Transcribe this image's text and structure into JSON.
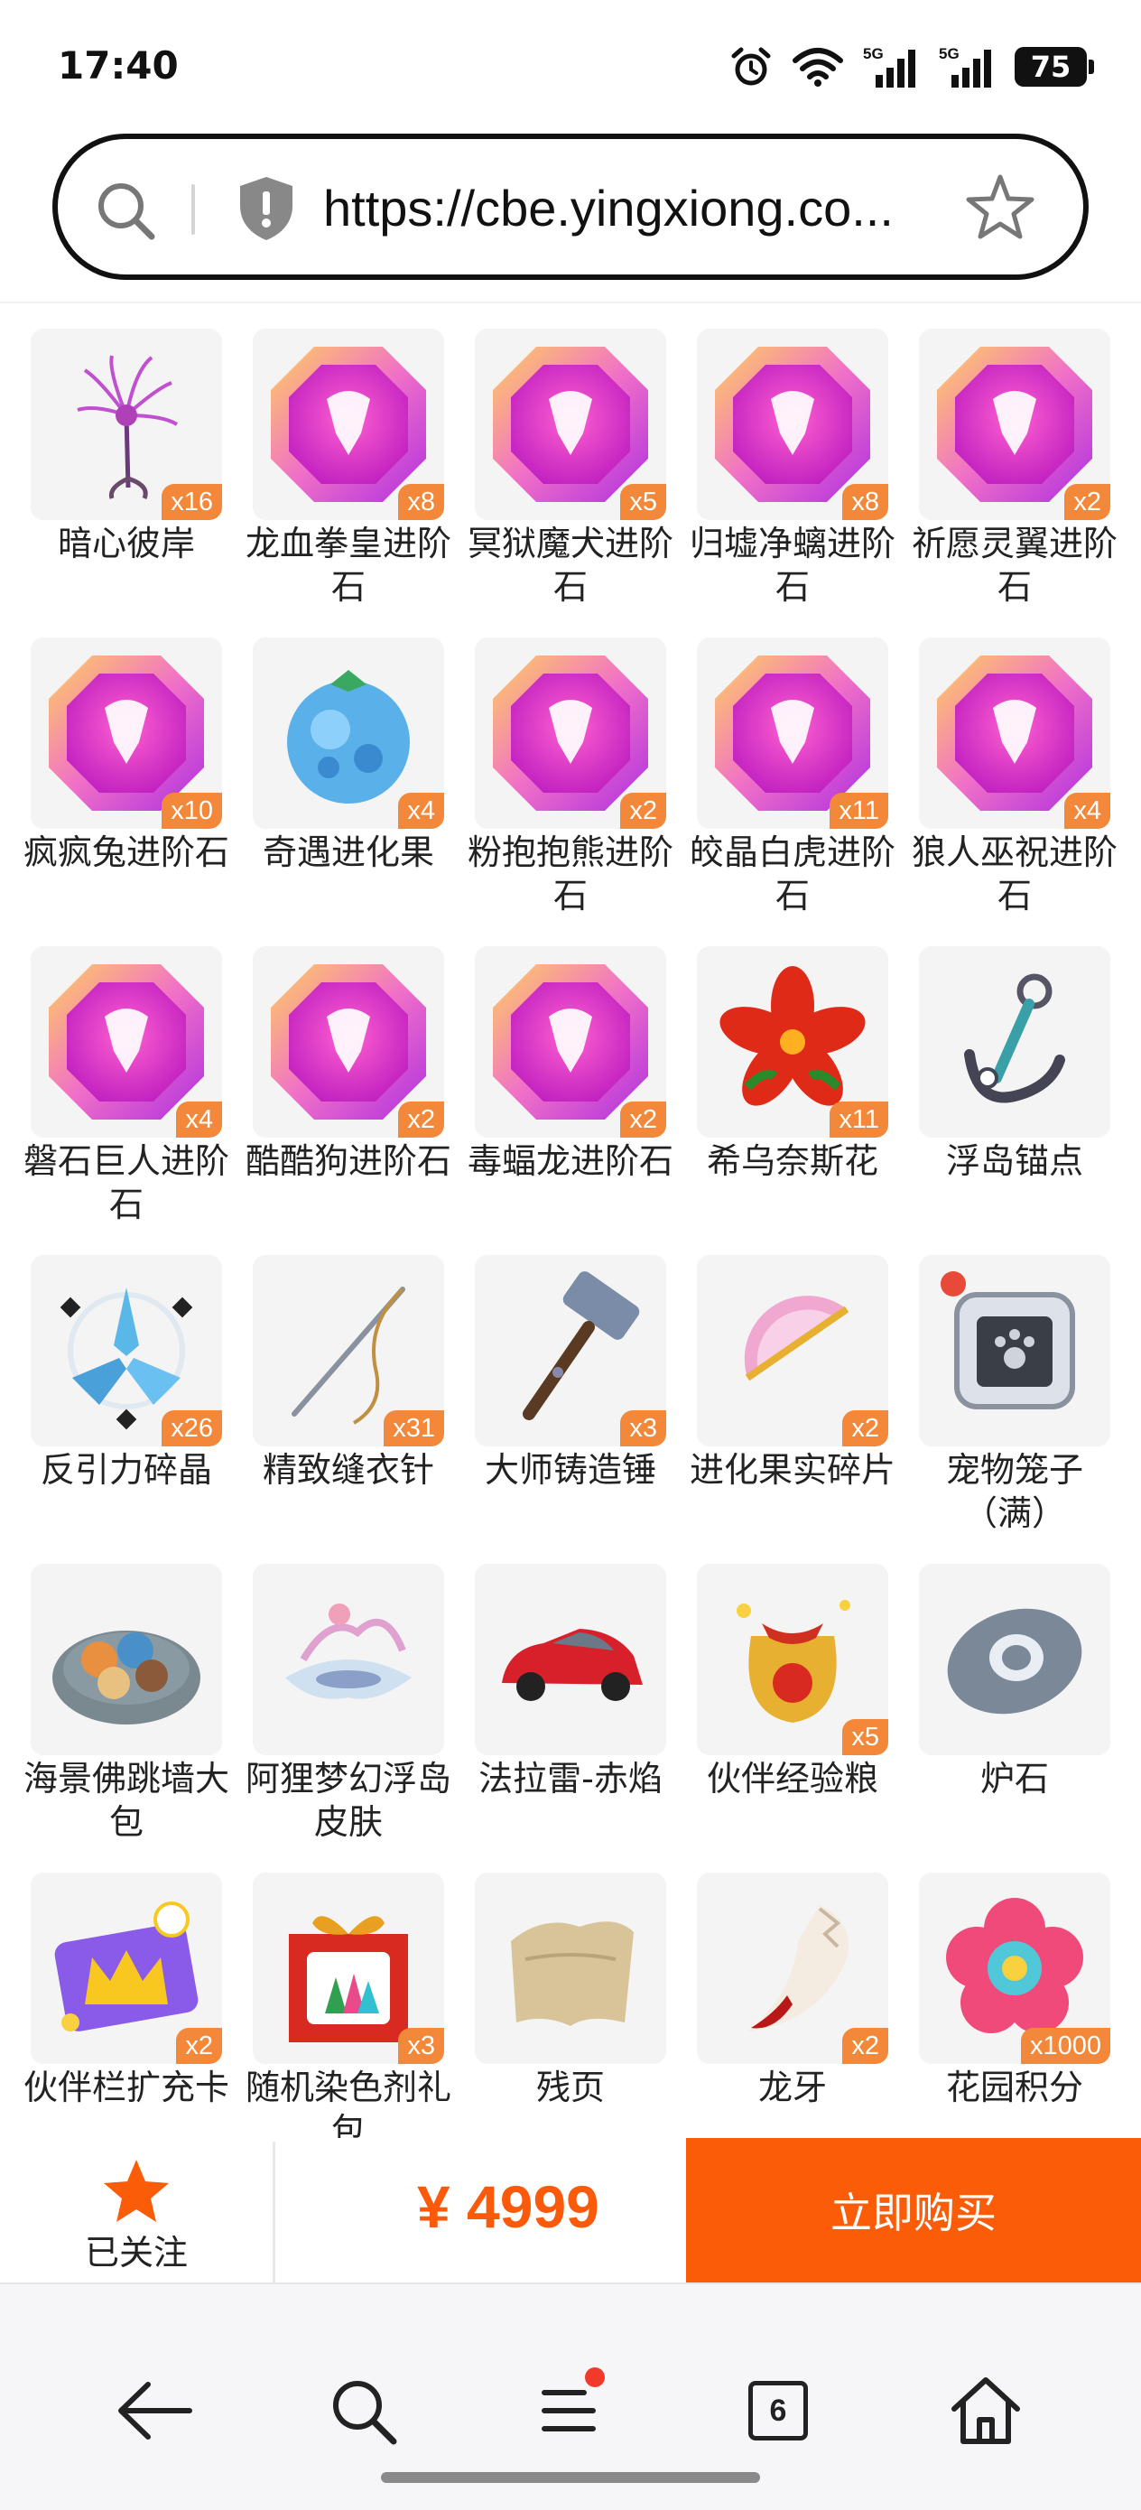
{
  "status_bar": {
    "time": "17:40",
    "battery": "75",
    "icons": [
      "alarm-icon",
      "wifi-icon",
      "signal-5g-icon",
      "signal-5g-icon",
      "battery-icon"
    ]
  },
  "browser": {
    "url": "https://cbe.yingxiong.co...",
    "icons": [
      "search-icon",
      "shield-icon",
      "star-icon"
    ]
  },
  "items": [
    {
      "name": "暗心彼岸",
      "badge": "x16",
      "icon": "spider-lily-icon"
    },
    {
      "name": "龙血拳皇进阶石",
      "badge": "x8",
      "icon": "advancement-gem-icon"
    },
    {
      "name": "冥狱魔犬进阶石",
      "badge": "x5",
      "icon": "advancement-gem-icon"
    },
    {
      "name": "归墟净螭进阶石",
      "badge": "x8",
      "icon": "advancement-gem-icon"
    },
    {
      "name": "祈愿灵翼进阶石",
      "badge": "x2",
      "icon": "advancement-gem-icon"
    },
    {
      "name": "疯疯兔进阶石",
      "badge": "x10",
      "icon": "advancement-gem-icon"
    },
    {
      "name": "奇遇进化果",
      "badge": "x4",
      "icon": "evolution-fruit-icon"
    },
    {
      "name": "粉抱抱熊进阶石",
      "badge": "x2",
      "icon": "advancement-gem-icon"
    },
    {
      "name": "皎晶白虎进阶石",
      "badge": "x11",
      "icon": "advancement-gem-icon"
    },
    {
      "name": "狼人巫祝进阶石",
      "badge": "x4",
      "icon": "advancement-gem-icon"
    },
    {
      "name": "磐石巨人进阶石",
      "badge": "x4",
      "icon": "advancement-gem-icon"
    },
    {
      "name": "酷酷狗进阶石",
      "badge": "x2",
      "icon": "advancement-gem-icon"
    },
    {
      "name": "毒蝠龙进阶石",
      "badge": "x2",
      "icon": "advancement-gem-icon"
    },
    {
      "name": "希乌奈斯花",
      "badge": "x11",
      "icon": "red-flower-icon"
    },
    {
      "name": "浮岛锚点",
      "badge": "",
      "icon": "anchor-icon"
    },
    {
      "name": "反引力碎晶",
      "badge": "x26",
      "icon": "crystal-shard-icon"
    },
    {
      "name": "精致缝衣针",
      "badge": "x31",
      "icon": "needle-icon"
    },
    {
      "name": "大师铸造锤",
      "badge": "x3",
      "icon": "hammer-icon"
    },
    {
      "name": "进化果实碎片",
      "badge": "x2",
      "icon": "fruit-slice-icon"
    },
    {
      "name": "宠物笼子（满）",
      "badge": "",
      "icon": "pet-cage-icon"
    },
    {
      "name": "海景佛跳墙大包",
      "badge": "",
      "icon": "food-bowl-icon"
    },
    {
      "name": "阿狸梦幻浮岛皮肤",
      "badge": "",
      "icon": "floating-island-icon"
    },
    {
      "name": "法拉雷-赤焰",
      "badge": "",
      "icon": "red-car-icon"
    },
    {
      "name": "伙伴经验粮",
      "badge": "x5",
      "icon": "treat-bag-icon"
    },
    {
      "name": "炉石",
      "badge": "",
      "icon": "hearthstone-icon"
    },
    {
      "name": "伙伴栏扩充卡",
      "badge": "x2",
      "icon": "crown-card-icon"
    },
    {
      "name": "随机染色剂礼包",
      "badge": "x3",
      "icon": "gift-box-icon"
    },
    {
      "name": "残页",
      "badge": "",
      "icon": "torn-page-icon"
    },
    {
      "name": "龙牙",
      "badge": "x2",
      "icon": "dragon-fang-icon"
    },
    {
      "name": "花园积分",
      "badge": "x1000",
      "icon": "flower-badge-icon"
    }
  ],
  "purchase": {
    "follow_label": "已关注",
    "price": "¥ 4999",
    "buy_label": "立即购买"
  },
  "nav": {
    "tab_count": "6",
    "icons": [
      "back-icon",
      "search-icon",
      "menu-icon",
      "tabs-icon",
      "home-icon"
    ]
  },
  "colors": {
    "accent": "#fb5c08",
    "price": "#fa5a0a",
    "badge": "#f4883a",
    "tile_bg": "#f4f4f4",
    "gem_outer": "#f0a830",
    "gem_inner": "#e040c0"
  }
}
